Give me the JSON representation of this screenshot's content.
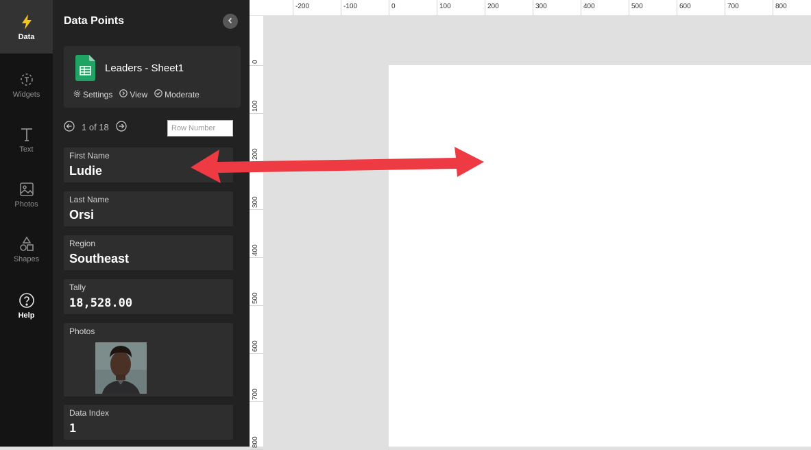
{
  "rail": {
    "items": [
      {
        "label": "Data",
        "icon": "bolt-icon"
      },
      {
        "label": "Widgets",
        "icon": "widgets-icon"
      },
      {
        "label": "Text",
        "icon": "text-icon"
      },
      {
        "label": "Photos",
        "icon": "photo-icon"
      },
      {
        "label": "Shapes",
        "icon": "shapes-icon"
      },
      {
        "label": "Help",
        "icon": "help-icon"
      }
    ]
  },
  "panel": {
    "title": "Data Points",
    "source": {
      "name": "Leaders - Sheet1",
      "actions": {
        "settings": "Settings",
        "view": "View",
        "moderate": "Moderate"
      }
    },
    "pager": {
      "text": "1 of 18",
      "row_placeholder": "Row Number"
    },
    "fields": [
      {
        "label": "First Name",
        "value": "Ludie"
      },
      {
        "label": "Last Name",
        "value": "Orsi"
      },
      {
        "label": "Region",
        "value": "Southeast"
      },
      {
        "label": "Tally",
        "value": "18,528.00"
      },
      {
        "label": "Photos",
        "value": ""
      },
      {
        "label": "Data Index",
        "value": "1"
      }
    ]
  },
  "ruler": {
    "top_labels": [
      "-200",
      "-100",
      "0",
      "100",
      "200",
      "300",
      "400",
      "500",
      "600",
      "700",
      "800"
    ],
    "left_labels": [
      "0",
      "100",
      "200",
      "300",
      "400",
      "500",
      "600",
      "700",
      "800"
    ]
  },
  "colors": {
    "accent": "#f5c518",
    "sheets_green": "#1fa463",
    "arrow_red": "#ee3a43"
  }
}
